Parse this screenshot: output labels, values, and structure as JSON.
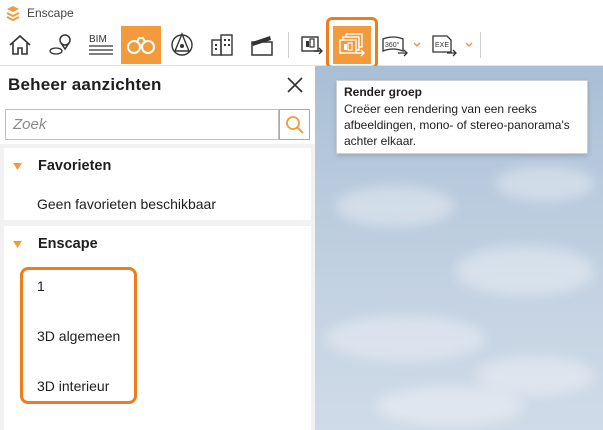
{
  "window": {
    "title": "Enscape"
  },
  "toolbar": {
    "accent": "#f39a3d",
    "highlight_color": "#f07d1b",
    "buttons": [
      {
        "name": "home-icon"
      },
      {
        "name": "map-pin-icon"
      },
      {
        "name": "bim-icon",
        "label": "BIM"
      },
      {
        "name": "binoculars-icon",
        "active": true
      },
      {
        "name": "perspective-icon"
      },
      {
        "name": "buildings-icon"
      },
      {
        "name": "clapperboard-icon"
      },
      {
        "name": "render-screenshot-icon"
      },
      {
        "name": "render-batch-icon",
        "highlighted": true
      },
      {
        "name": "panorama-export-icon",
        "label": "360°"
      },
      {
        "name": "exe-export-icon",
        "label": "EXE"
      }
    ]
  },
  "tooltip": {
    "title": "Render groep",
    "body": "Creëer een rendering van een reeks afbeeldingen, mono- of stereo-panorama's achter elkaar."
  },
  "panel": {
    "title": "Beheer aanzichten",
    "search": {
      "placeholder": "Zoek"
    },
    "favorites": {
      "label": "Favorieten",
      "empty_text": "Geen favorieten beschikbaar"
    },
    "enscape": {
      "label": "Enscape",
      "views": [
        "1",
        "3D algemeen",
        "3D interieur"
      ]
    }
  }
}
